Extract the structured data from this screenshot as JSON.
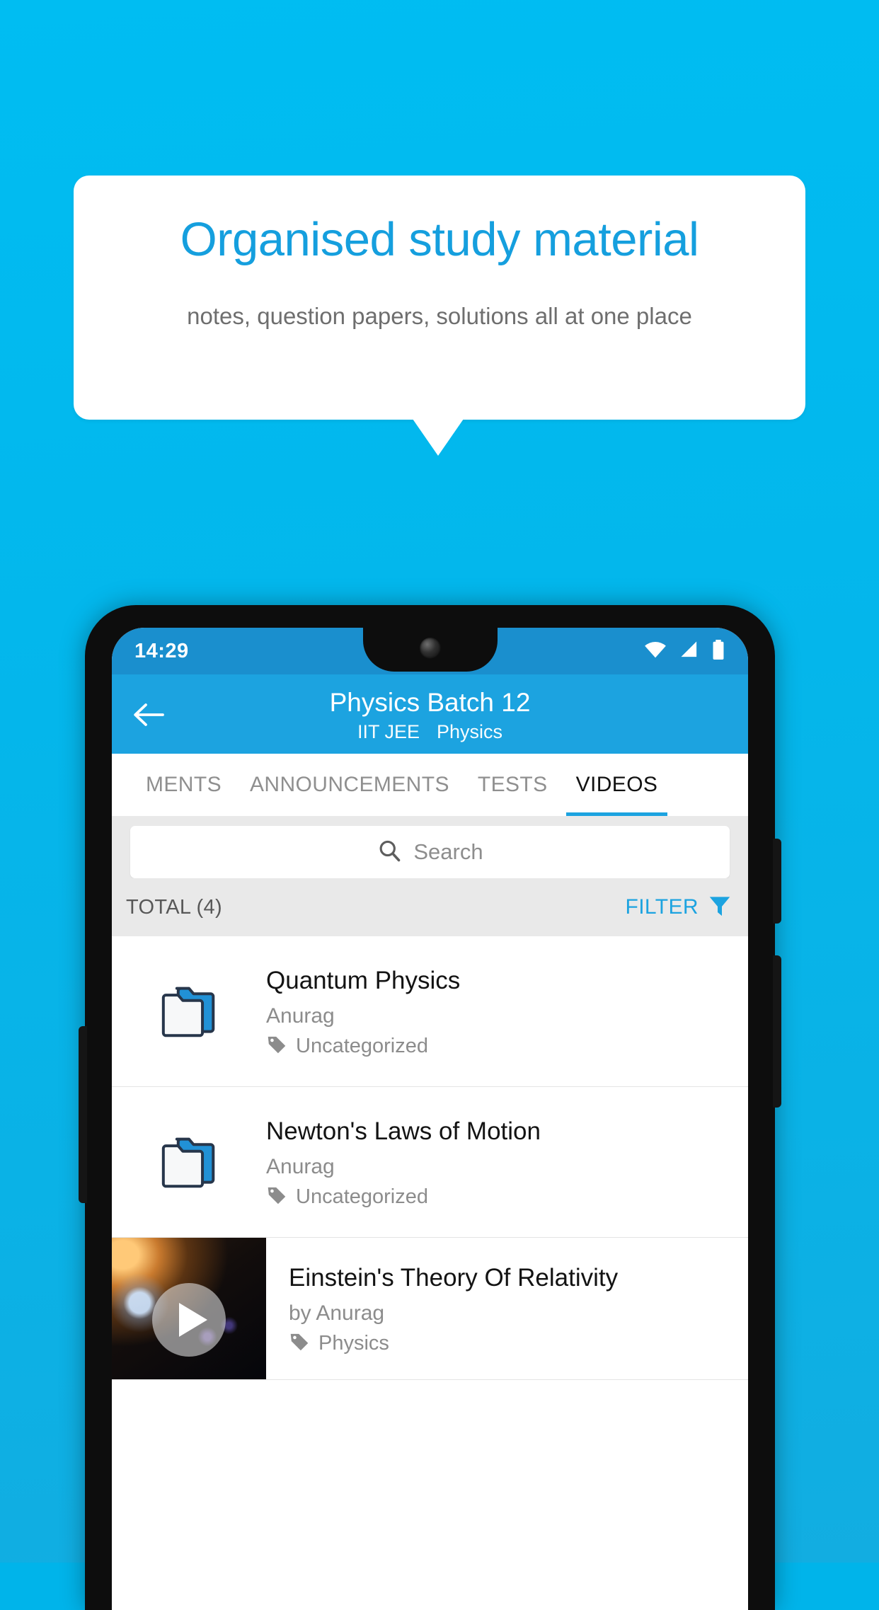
{
  "promo": {
    "title": "Organised study material",
    "subtitle": "notes, question papers, solutions all at one place",
    "title_color": "#159fde",
    "subtitle_color": "#6e6e6e",
    "background_color": "#00b4ea",
    "card_color": "#ffffff"
  },
  "phone": {
    "status_bar": {
      "time": "14:29",
      "icons": [
        "wifi-icon",
        "signal-icon",
        "battery-icon"
      ],
      "background_color": "#1a8fce"
    },
    "app_bar": {
      "back_icon": "back-arrow-icon",
      "title": "Physics Batch 12",
      "subtitle_exam": "IIT JEE",
      "subtitle_subject": "Physics",
      "background_color": "#1ca3e0"
    },
    "tabs": [
      {
        "label": "MENTS",
        "active": false
      },
      {
        "label": "ANNOUNCEMENTS",
        "active": false
      },
      {
        "label": "TESTS",
        "active": false
      },
      {
        "label": "VIDEOS",
        "active": true
      }
    ],
    "search": {
      "placeholder": "Search",
      "value": "",
      "icon": "search-icon"
    },
    "list_header": {
      "total_label": "TOTAL (4)",
      "filter_label": "FILTER",
      "filter_icon": "filter-funnel-icon",
      "filter_color": "#1ca3e0"
    },
    "items": [
      {
        "type": "folder",
        "icon": "folder-icon",
        "title": "Quantum Physics",
        "author": "Anurag",
        "tag_icon": "tag-icon",
        "tag": "Uncategorized"
      },
      {
        "type": "folder",
        "icon": "folder-icon",
        "title": "Newton's Laws of Motion",
        "author": "Anurag",
        "tag_icon": "tag-icon",
        "tag": "Uncategorized"
      },
      {
        "type": "video",
        "icon": "play-icon",
        "title": "Einstein's Theory Of Relativity",
        "author": "by Anurag",
        "tag_icon": "tag-icon",
        "tag": "Physics"
      }
    ]
  }
}
